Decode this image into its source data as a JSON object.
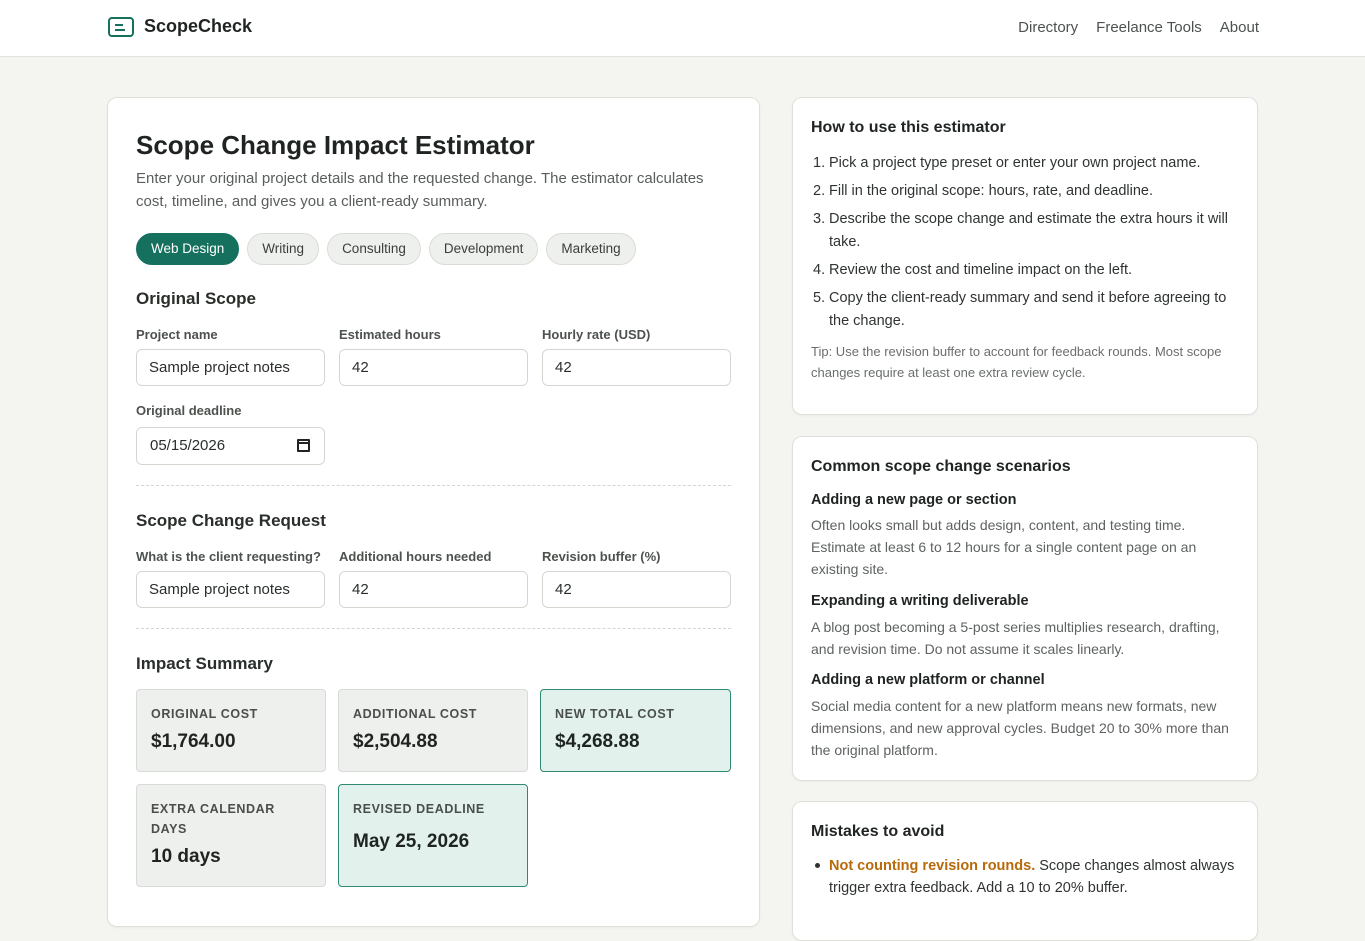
{
  "brand": {
    "name": "ScopeCheck",
    "icon": "document-icon"
  },
  "nav": [
    "Directory",
    "Freelance Tools",
    "About"
  ],
  "main": {
    "title": "Scope Change Impact Estimator",
    "intro": "Enter your original project details and the requested change. The estimator calculates cost, timeline, and gives you a client-ready summary.",
    "presets": [
      "Web Design",
      "Writing",
      "Consulting",
      "Development",
      "Marketing"
    ],
    "active_preset": "Web Design",
    "original_scope": {
      "title": "Original Scope",
      "project_name_label": "Project name",
      "project_name_value": "Sample project notes",
      "hours_label": "Estimated hours",
      "hours_value": "42",
      "rate_label": "Hourly rate (USD)",
      "rate_value": "42",
      "deadline_label": "Original deadline",
      "deadline_value": "05/15/2026"
    },
    "change_request": {
      "title": "Scope Change Request",
      "request_label": "What is the client requesting?",
      "request_value": "Sample project notes",
      "extra_hours_label": "Additional hours needed",
      "extra_hours_value": "42",
      "buffer_label": "Revision buffer (%)",
      "buffer_value": "42"
    },
    "impact": {
      "title": "Impact Summary",
      "original_cost_label": "Original Cost",
      "original_cost": "$1,764.00",
      "additional_cost_label": "Additional Cost",
      "additional_cost": "$2,504.88",
      "new_total_label": "New Total Cost",
      "new_total": "$4,268.88",
      "extra_days_label": "Extra Calendar Days",
      "extra_days": "10 days",
      "revised_deadline_label": "Revised Deadline",
      "revised_deadline": "May 25, 2026"
    }
  },
  "how_to": {
    "title": "How to use this estimator",
    "steps": [
      "Pick a project type preset or enter your own project name.",
      "Fill in the original scope: hours, rate, and deadline.",
      "Describe the scope change and estimate the extra hours it will take.",
      "Review the cost and timeline impact on the left.",
      "Copy the client-ready summary and send it before agreeing to the change."
    ],
    "tip": "Tip: Use the revision buffer to account for feedback rounds. Most scope changes require at least one extra review cycle."
  },
  "scenarios": {
    "title": "Common scope change scenarios",
    "items": [
      {
        "title": "Adding a new page or section",
        "text": "Often looks small but adds design, content, and testing time. Estimate at least 6 to 12 hours for a single content page on an existing site."
      },
      {
        "title": "Expanding a writing deliverable",
        "text": "A blog post becoming a 5-post series multiplies research, drafting, and revision time. Do not assume it scales linearly."
      },
      {
        "title": "Adding a new platform or channel",
        "text": "Social media content for a new platform means new formats, new dimensions, and new approval cycles. Budget 20 to 30% more than the original platform."
      }
    ]
  },
  "mistakes": {
    "title": "Mistakes to avoid",
    "items": [
      {
        "highlight": "Not counting revision rounds.",
        "text": "Scope changes almost always trigger extra feedback. Add a 10 to 20% buffer."
      }
    ]
  },
  "colors": {
    "accent": "#16705e",
    "warning": "#b86a0a",
    "background": "#f4f4f1"
  }
}
